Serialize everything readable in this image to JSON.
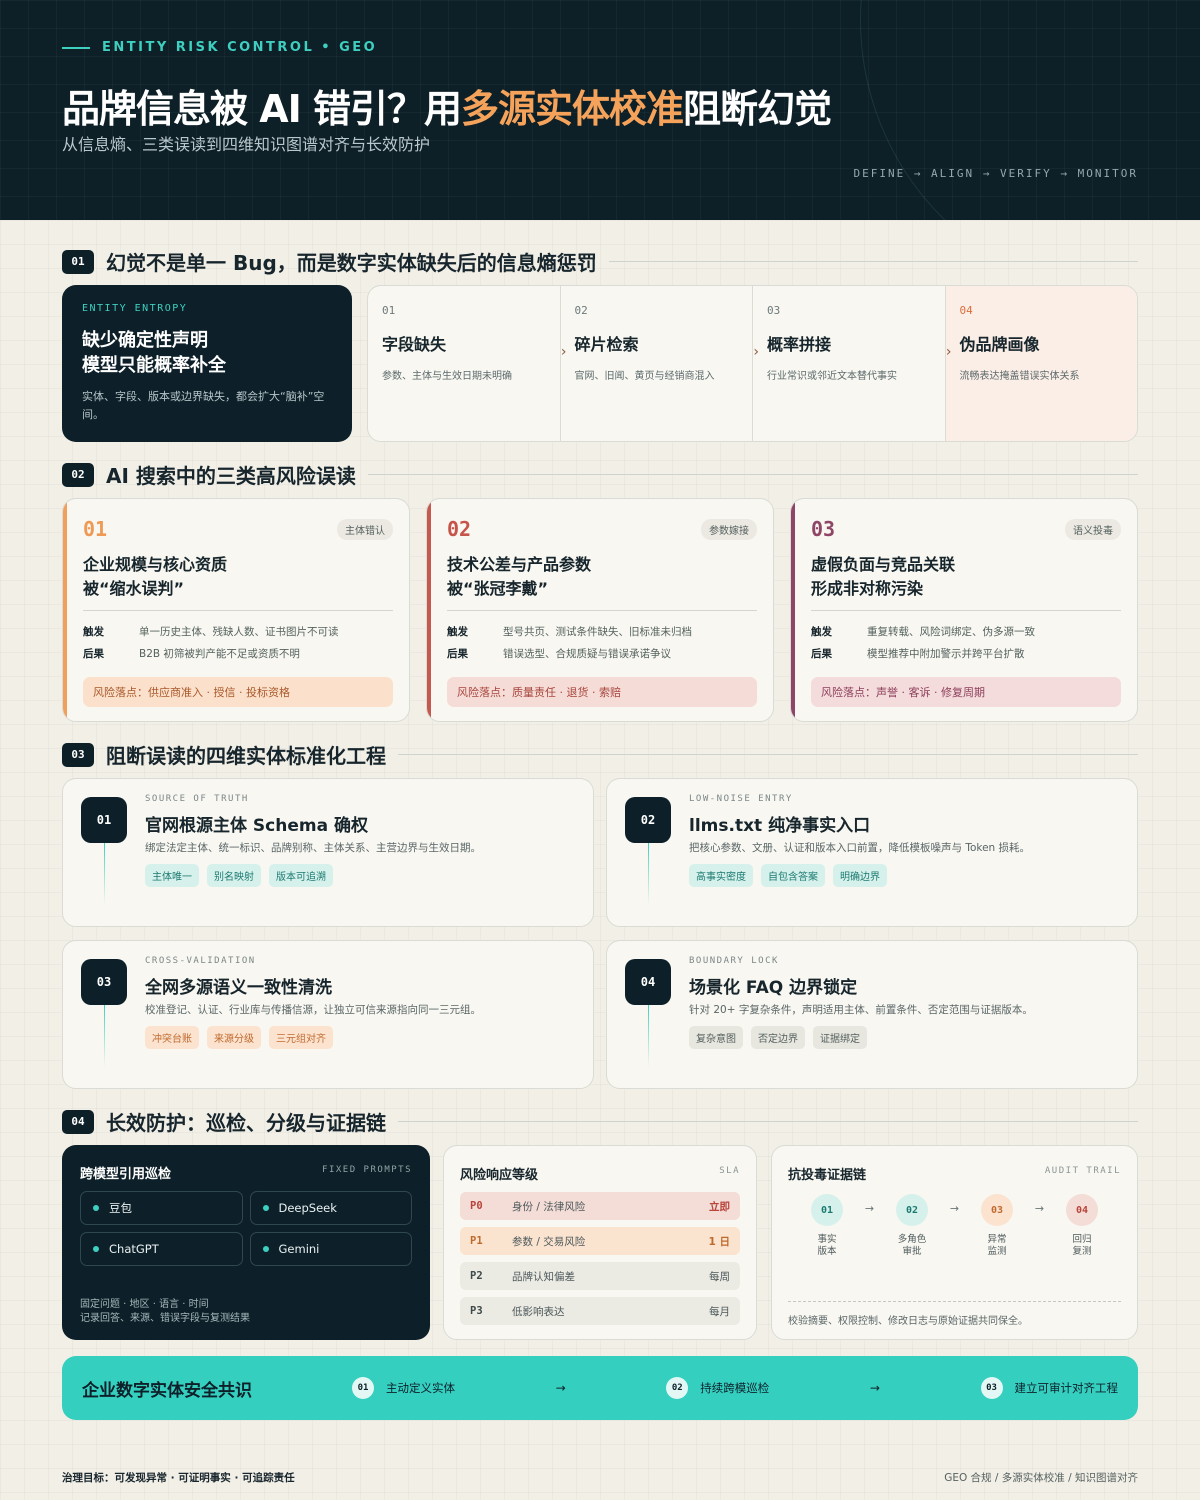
{
  "header": {
    "eyebrow": "ENTITY RISK CONTROL • GEO",
    "title_pre": "品牌信息被 AI 错引？用",
    "title_accent": "多源实体校准",
    "title_post": "阻断幻觉",
    "subtitle": "从信息熵、三类误读到四维知识图谱对齐与长效防护",
    "flow": "DEFINE → ALIGN → VERIFY → MONITOR"
  },
  "colors": {
    "dark": "#0d1f27",
    "teal": "#3ecfc0",
    "orange": "#f5a25b",
    "red": "#c45a4f",
    "plum": "#8e4566"
  },
  "section1": {
    "num": "01",
    "title": "幻觉不是单一 Bug，而是数字实体缺失后的信息熵惩罚",
    "entropy": {
      "label": "ENTITY ENTROPY",
      "title": "缺少确定性声明\n模型只能概率补全",
      "desc": "实体、字段、版本或边界缺失，都会扩大“脑补”空间。"
    },
    "steps": [
      {
        "n": "01",
        "title": "字段缺失",
        "desc": "参数、主体与生效日期未明确"
      },
      {
        "n": "02",
        "title": "碎片检索",
        "desc": "官网、旧闻、黄页与经销商混入"
      },
      {
        "n": "03",
        "title": "概率拼接",
        "desc": "行业常识或邻近文本替代事实"
      },
      {
        "n": "04",
        "title": "伪品牌画像",
        "desc": "流畅表达掩盖错误实体关系"
      }
    ]
  },
  "section2": {
    "num": "02",
    "title": "AI 搜索中的三类高风险误读",
    "cards": [
      {
        "n": "01",
        "tag": "主体错认",
        "title": "企业规模与核心资质\n被“缩水误判”",
        "trigger_label": "触发",
        "trigger": "单一历史主体、残缺人数、证书图片不可读",
        "result_label": "后果",
        "result": "B2B 初筛被判产能不足或资质不明",
        "landing": "风险落点：供应商准入 · 授信 · 投标资格"
      },
      {
        "n": "02",
        "tag": "参数嫁接",
        "title": "技术公差与产品参数\n被“张冠李戴”",
        "trigger_label": "触发",
        "trigger": "型号共页、测试条件缺失、旧标准未归档",
        "result_label": "后果",
        "result": "错误选型、合规质疑与错误承诺争议",
        "landing": "风险落点：质量责任 · 退货 · 索赔"
      },
      {
        "n": "03",
        "tag": "语义投毒",
        "title": "虚假负面与竞品关联\n形成非对称污染",
        "trigger_label": "触发",
        "trigger": "重复转载、风险词绑定、伪多源一致",
        "result_label": "后果",
        "result": "模型推荐中附加警示并跨平台扩散",
        "landing": "风险落点：声誉 · 客诉 · 修复周期"
      }
    ]
  },
  "section3": {
    "num": "03",
    "title": "阻断误读的四维实体标准化工程",
    "items": [
      {
        "n": "01",
        "label": "SOURCE OF TRUTH",
        "title": "官网根源主体 Schema 确权",
        "desc": "绑定法定主体、统一标识、品牌别称、主体关系、主营边界与生效日期。",
        "chips": [
          "主体唯一",
          "别名映射",
          "版本可追溯"
        ]
      },
      {
        "n": "02",
        "label": "LOW-NOISE ENTRY",
        "title": "llms.txt 纯净事实入口",
        "desc": "把核心参数、文册、认证和版本入口前置，降低模板噪声与 Token 损耗。",
        "chips": [
          "高事实密度",
          "自包含答案",
          "明确边界"
        ]
      },
      {
        "n": "03",
        "label": "CROSS-VALIDATION",
        "title": "全网多源语义一致性清洗",
        "desc": "校准登记、认证、行业库与传播信源，让独立可信来源指向同一三元组。",
        "chips": [
          "冲突台账",
          "来源分级",
          "三元组对齐"
        ]
      },
      {
        "n": "04",
        "label": "BOUNDARY LOCK",
        "title": "场景化 FAQ 边界锁定",
        "desc": "针对 20+ 字复杂条件，声明适用主体、前置条件、否定范围与证据版本。",
        "chips": [
          "复杂意图",
          "否定边界",
          "证据绑定"
        ]
      }
    ]
  },
  "section4": {
    "num": "04",
    "title": "长效防护：巡检、分级与证据链",
    "patrol": {
      "title": "跨模型引用巡检",
      "label": "FIXED PROMPTS",
      "models": [
        "豆包",
        "DeepSeek",
        "ChatGPT",
        "Gemini"
      ],
      "note1": "固定问题 · 地区 · 语言 · 时间",
      "note2": "记录回答、来源、错误字段与复测结果"
    },
    "sla": {
      "title": "风险响应等级",
      "label": "SLA",
      "rows": [
        {
          "p": "P0",
          "desc": "身份 / 法律风险",
          "when": "立即"
        },
        {
          "p": "P1",
          "desc": "参数 / 交易风险",
          "when": "1 日"
        },
        {
          "p": "P2",
          "desc": "品牌认知偏差",
          "when": "每周"
        },
        {
          "p": "P3",
          "desc": "低影响表达",
          "when": "每月"
        }
      ]
    },
    "audit": {
      "title": "抗投毒证据链",
      "label": "AUDIT TRAIL",
      "nodes": [
        {
          "n": "01",
          "label": "事实\n版本"
        },
        {
          "n": "02",
          "label": "多角色\n审批"
        },
        {
          "n": "03",
          "label": "异常\n监测"
        },
        {
          "n": "04",
          "label": "回归\n复测"
        }
      ],
      "note": "校验摘要、权限控制、修改日志与原始证据共同保全。"
    }
  },
  "consensus": {
    "title": "企业数字实体安全共识",
    "items": [
      {
        "n": "01",
        "label": "主动定义实体"
      },
      {
        "n": "02",
        "label": "持续跨模巡检"
      },
      {
        "n": "03",
        "label": "建立可审计对齐工程"
      }
    ]
  },
  "footer": {
    "left": "治理目标：可发现异常 · 可证明事实 · 可追踪责任",
    "right": "GEO 合规 / 多源实体校准 / 知识图谱对齐"
  }
}
